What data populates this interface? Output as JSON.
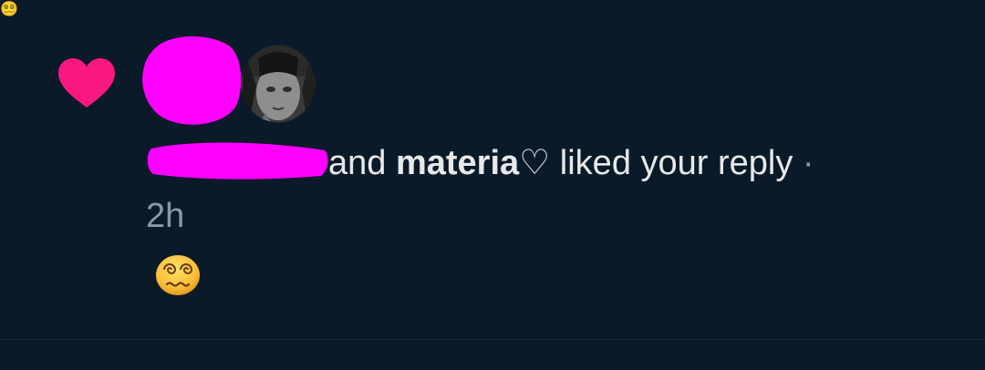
{
  "notification": {
    "icon": "heart-icon",
    "icon_color": "#f91880",
    "redaction_color": "#ff00ff",
    "message": {
      "connector": "and",
      "actor_name": "materia♡",
      "action": "liked your reply",
      "separator": "·",
      "timestamp": "2h"
    },
    "reply_content": "😵‍💫"
  }
}
